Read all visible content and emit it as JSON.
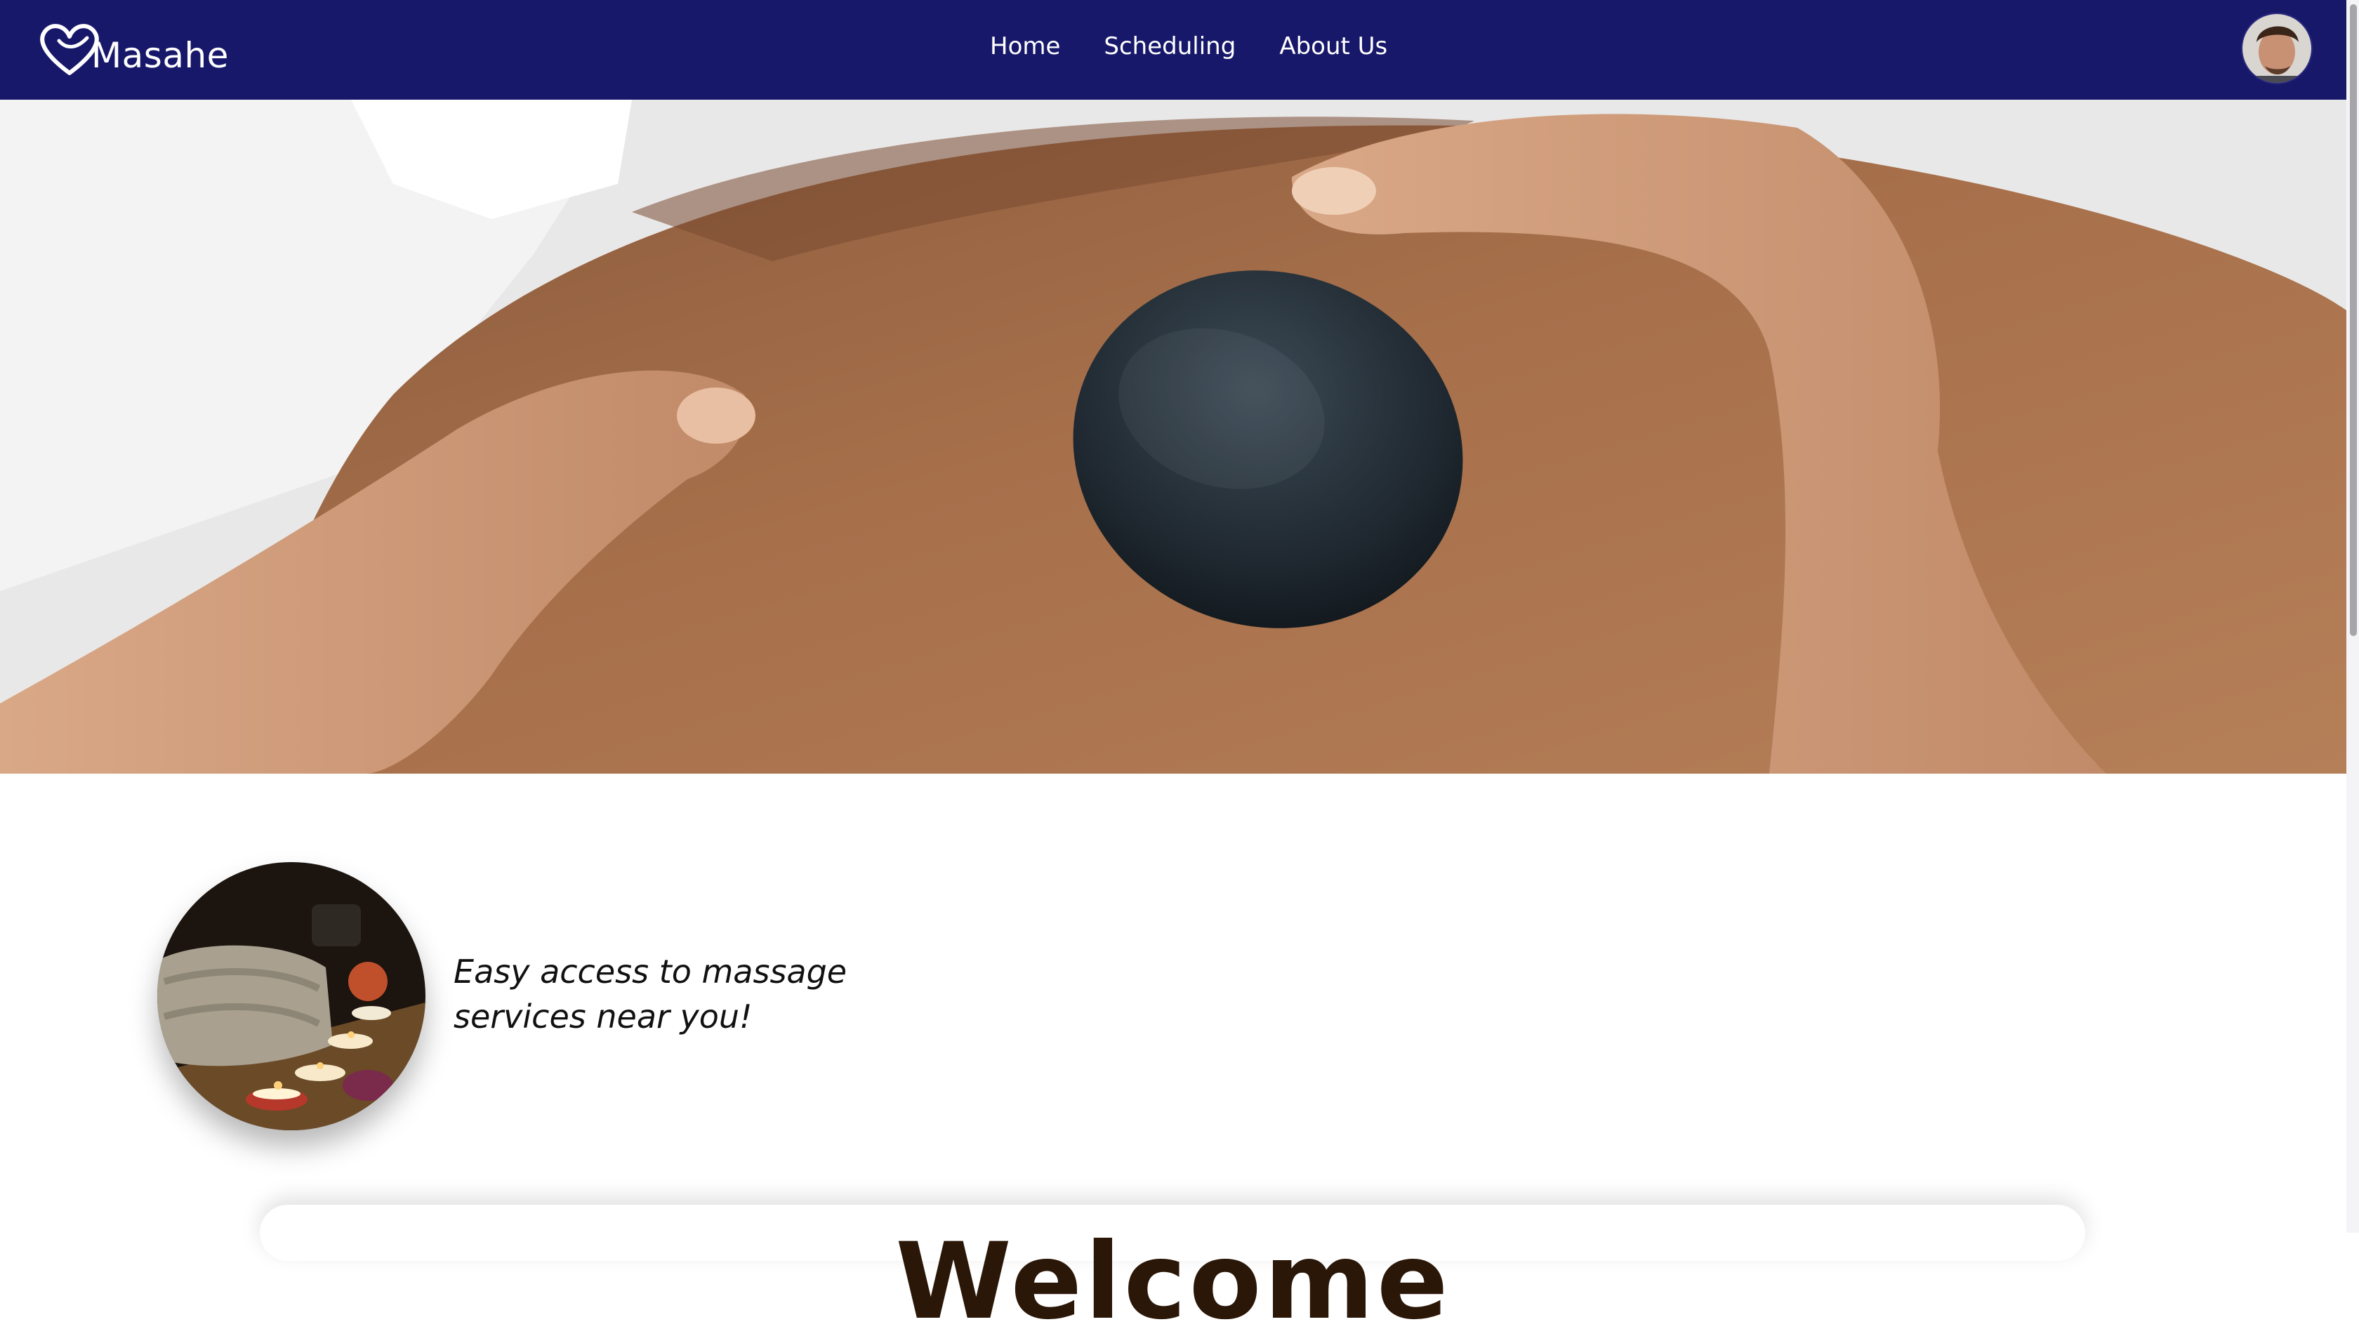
{
  "brand": {
    "name": "Masahe",
    "logo_icon": "heart-icon"
  },
  "nav": {
    "items": [
      {
        "label": "Home"
      },
      {
        "label": "Scheduling"
      },
      {
        "label": "About Us"
      }
    ]
  },
  "user": {
    "avatar_icon": "user-avatar"
  },
  "hero": {
    "image": "hot-stone-massage-photo"
  },
  "feature": {
    "image": "spa-candles-towels-photo",
    "tagline": "Easy access to massage services near you!"
  },
  "welcome": {
    "heading": "Welcome"
  },
  "colors": {
    "navbar": "#18186b",
    "text_dark": "#2b1708",
    "accent_white": "#ffffff"
  }
}
